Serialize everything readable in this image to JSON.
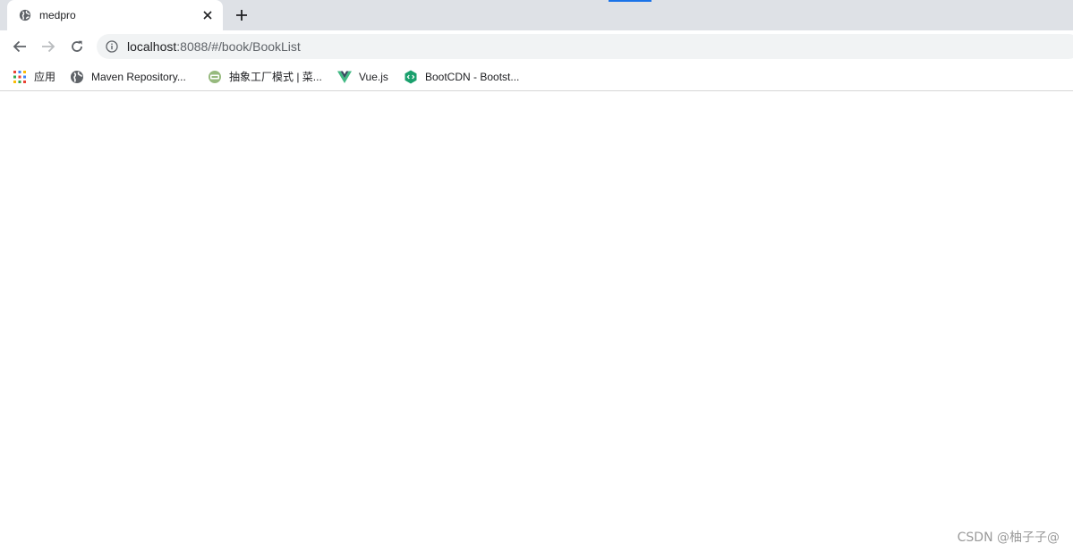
{
  "tab": {
    "title": "medpro",
    "favicon": "globe-icon"
  },
  "address_bar": {
    "host": "localhost",
    "rest": ":8088/#/book/BookList"
  },
  "bookmarks": [
    {
      "label": "应用",
      "icon": "apps-grid-icon"
    },
    {
      "label": "Maven Repository...",
      "icon": "globe-icon"
    },
    {
      "label": "抽象工厂模式 | 菜...",
      "icon": "runoob-icon"
    },
    {
      "label": "Vue.js",
      "icon": "vue-logo-icon"
    },
    {
      "label": "BootCDN - Bootst...",
      "icon": "bootcdn-icon"
    }
  ],
  "watermark": "CSDN @柚子子@",
  "colors": {
    "tabstrip": "#dee1e6",
    "omnibox": "#f1f3f4",
    "accent": "#1a73e8",
    "vue_green": "#41b883",
    "vue_dark": "#35495e",
    "bootcdn_green": "#1aa06d"
  }
}
